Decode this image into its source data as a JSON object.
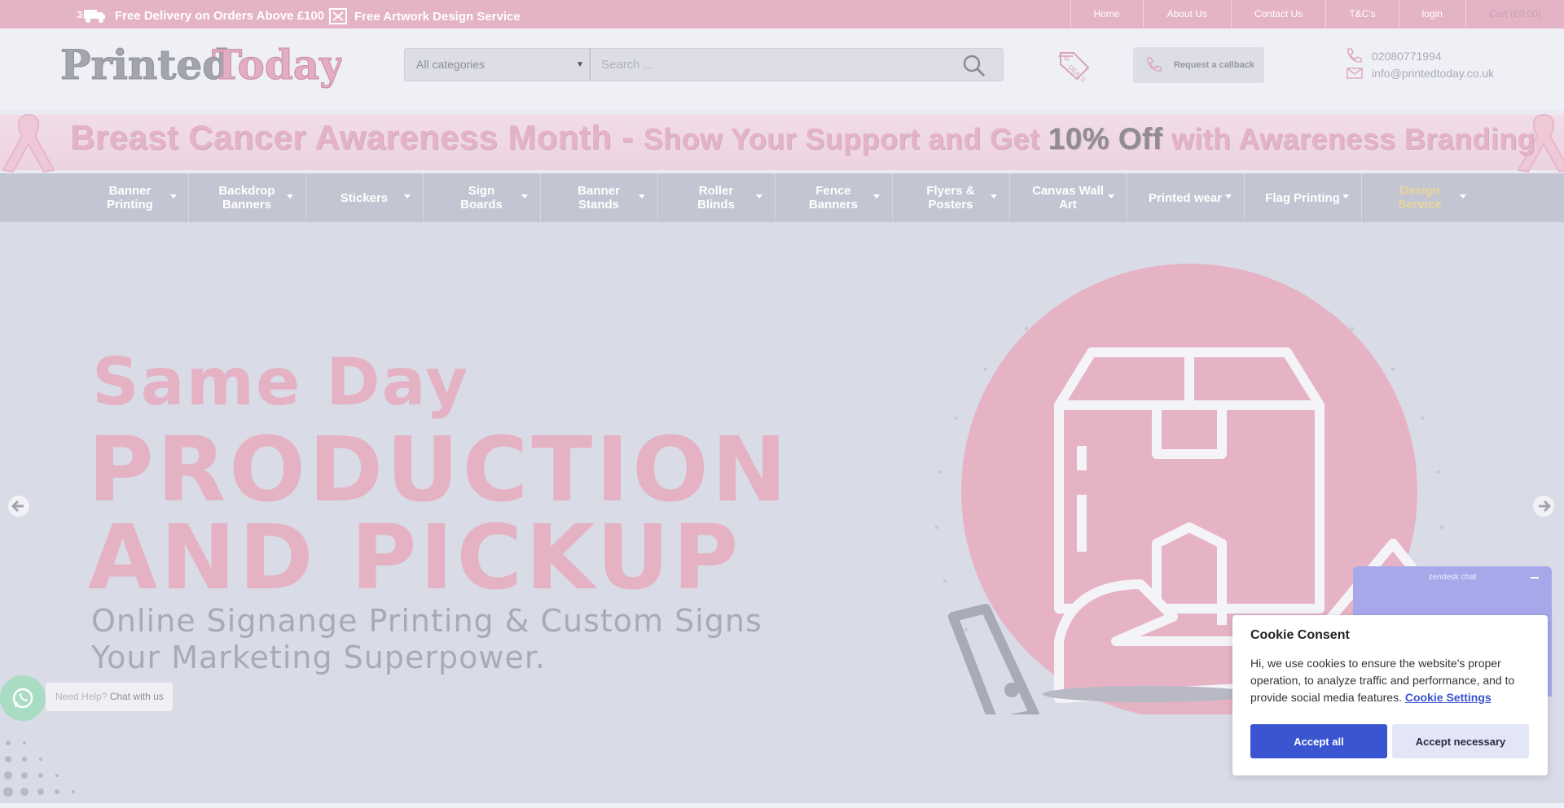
{
  "topbar": {
    "promo_delivery": "Free Delivery on Orders Above £100",
    "promo_artwork": "Free Artwork Design Service",
    "links": [
      "Home",
      "About Us",
      "Contact Us",
      "T&C's",
      "login",
      "Cart (£0.00)"
    ]
  },
  "header": {
    "logo_text": "PrintedToday",
    "category_selected": "All categories",
    "search_placeholder": "Search ...",
    "callback_label": "Request a callback",
    "phone": "02080771994",
    "email": "info@printedtoday.co.uk"
  },
  "banner": {
    "part1": "Breast Cancer Awareness Month - ",
    "part2": "Show Your Support and Get ",
    "part3": "10% Off",
    "part4": " with Awareness Branding"
  },
  "nav": {
    "items": [
      {
        "label": "Banner Printing"
      },
      {
        "label": "Backdrop Banners"
      },
      {
        "label": "Stickers"
      },
      {
        "label": "Sign Boards"
      },
      {
        "label": "Banner Stands"
      },
      {
        "label": "Roller Blinds"
      },
      {
        "label": "Fence Banners"
      },
      {
        "label": "Flyers & Posters"
      },
      {
        "label": "Canvas Wall Art"
      },
      {
        "label": "Printed wear"
      },
      {
        "label": "Flag Printing"
      },
      {
        "label": "Design Service"
      }
    ]
  },
  "hero": {
    "line1": "Same Day",
    "line2": "PRODUCTION",
    "line3": "AND PICKUP",
    "sub1": "Online Signange Printing & Custom Signs",
    "sub2": "Your Marketing Superpower."
  },
  "whatsapp": {
    "need_help": "Need Help? ",
    "chat": "Chat with us"
  },
  "zendesk": {
    "title": "zendesk chat"
  },
  "cookie": {
    "title": "Cookie Consent",
    "text": "Hi, we use cookies to ensure the website's proper operation, to analyze traffic and performance, and to provide social media features. ",
    "settings_link": "Cookie Settings",
    "accept_all": "Accept all",
    "accept_necessary": "Accept necessary"
  },
  "colors": {
    "brand_pink": "#e5b3c6",
    "nav_bg": "#c3c5d2",
    "accent_blue": "#3b54d0"
  }
}
